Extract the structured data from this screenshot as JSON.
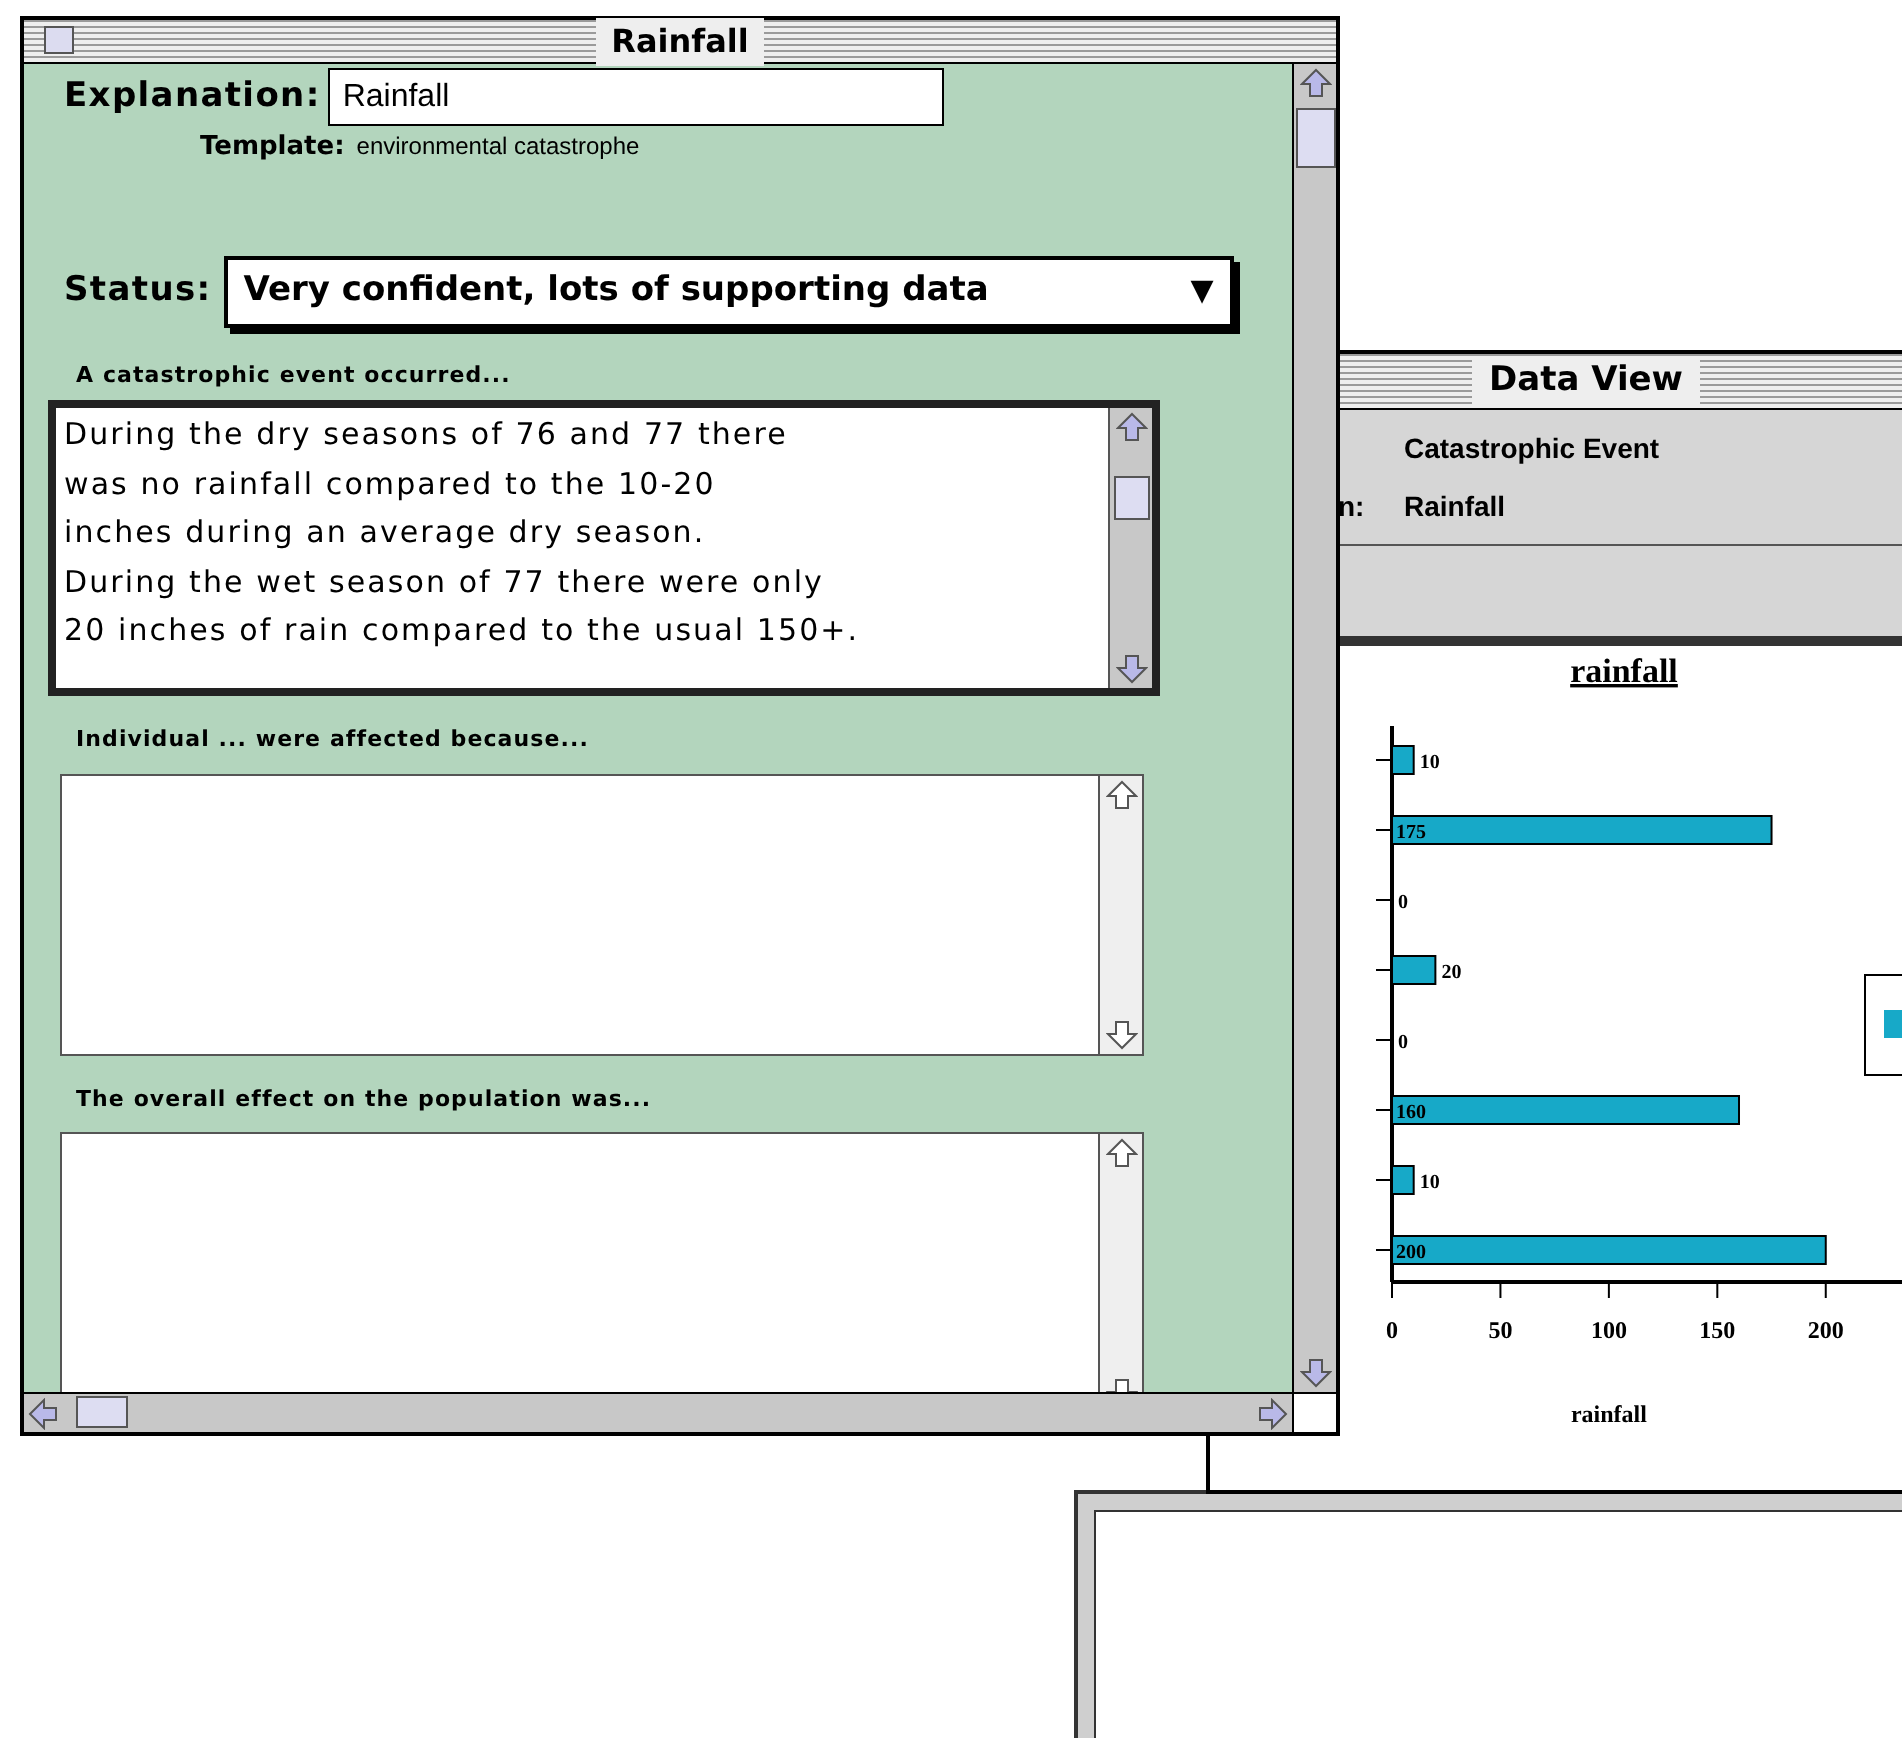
{
  "rainfall_window": {
    "title": "Rainfall",
    "explanation": {
      "label": "Explanation:",
      "value": "Rainfall"
    },
    "template": {
      "label": "Template:",
      "value": "environmental catastrophe"
    },
    "status": {
      "label": "Status:",
      "value": "Very confident, lots of supporting data",
      "arrow": "▼"
    },
    "sections": [
      {
        "label": "A catastrophic event occurred...",
        "text": "During the dry seasons of 76 and 77 there\nwas no rainfall compared to the 10-20\ninches during an average dry season.\nDuring the wet season of 77 there were only\n20 inches of rain compared to the usual 150+.",
        "focused": true
      },
      {
        "label": "Individual ... were affected because...",
        "focused": false
      },
      {
        "label": "The overall effect on the population was...",
        "focused": false
      }
    ]
  },
  "data_view_window": {
    "title": "Data View",
    "type_value": "Catastrophic Event",
    "explanation_label": "n:",
    "explanation_value": "Rainfall",
    "chart_data": {
      "type": "bar",
      "orientation": "horizontal",
      "title": "rainfall",
      "xlabel": "rainfall",
      "series": [
        {
          "color": "#17a9c8",
          "values": [
            10,
            175,
            0,
            20,
            0,
            160,
            10,
            200
          ]
        }
      ],
      "value_labels": [
        "10",
        "175",
        "0",
        "20",
        "0",
        "160",
        "10",
        "200"
      ],
      "xlim": [
        0,
        237
      ],
      "xticks": [
        0,
        50,
        100,
        150,
        200
      ],
      "data_labels": true
    }
  }
}
